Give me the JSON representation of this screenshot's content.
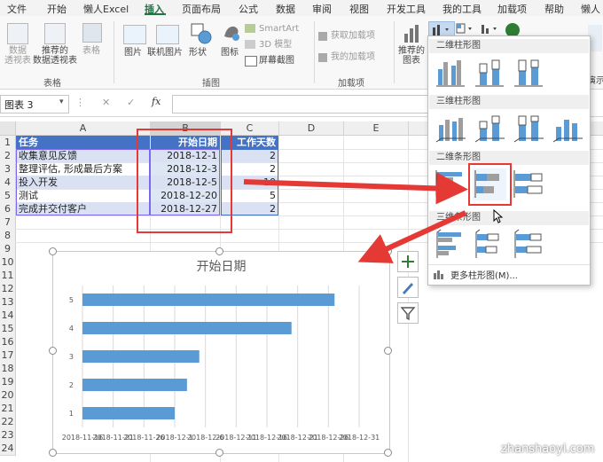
{
  "menu": {
    "tabs": [
      "文件",
      "开始",
      "懒人Excel",
      "插入",
      "页面布局",
      "公式",
      "数据",
      "审阅",
      "视图",
      "开发工具",
      "我的工具",
      "加载项",
      "帮助",
      "懒人"
    ],
    "active": "插入"
  },
  "ribbon": {
    "pivot_group": {
      "label": "表格",
      "items": [
        "数据\n透视表",
        "推荐的\n数据透视表",
        "表格"
      ]
    },
    "illustrations_group": {
      "label": "插图",
      "items": [
        "图片",
        "联机图片",
        "形状",
        "图标",
        "SmartArt",
        "3D 模型",
        "屏幕截图"
      ]
    },
    "addins_group": {
      "label": "加载项",
      "items": [
        "获取加载项",
        "我的加载项"
      ]
    },
    "recommended_charts": "推荐的\n图表",
    "demo_label": "演示"
  },
  "formula_bar": {
    "name_box": "图表 3",
    "fx": "fx",
    "cancel": "✕",
    "enter": "✓"
  },
  "sheet": {
    "columns": [
      "A",
      "B",
      "C",
      "D",
      "E"
    ],
    "row_numbers": [
      "1",
      "2",
      "3",
      "4",
      "5",
      "6",
      "7",
      "8",
      "9",
      "10",
      "11",
      "12",
      "13",
      "14",
      "15",
      "16",
      "17",
      "18",
      "19",
      "20",
      "21",
      "22",
      "23",
      "24"
    ],
    "headers": [
      "任务",
      "开始日期",
      "工作天数"
    ],
    "rows": [
      [
        "收集意见反馈",
        "2018-12-1",
        "2"
      ],
      [
        "整理评估, 形成最后方案",
        "2018-12-3",
        "2"
      ],
      [
        "投入开发",
        "2018-12-5",
        "10"
      ],
      [
        "测试",
        "2018-12-20",
        "5"
      ],
      [
        "完成并交付客户",
        "2018-12-27",
        "2"
      ]
    ]
  },
  "dropdown": {
    "sections": [
      "二维柱形图",
      "三维柱形图",
      "二维条形图",
      "三维条形图"
    ],
    "more": "更多柱形图(M)..."
  },
  "colors": {
    "accent": "#217346",
    "table_header": "#4472c4",
    "band": "#d9e1f2",
    "bar": "#5b9bd5",
    "highlight": "#e53935"
  },
  "chart_data": {
    "type": "bar",
    "orientation": "horizontal",
    "title": "开始日期",
    "categories": [
      "1",
      "2",
      "3",
      "4",
      "5"
    ],
    "values": [
      "2018-12-1",
      "2018-12-3",
      "2018-12-5",
      "2018-12-20",
      "2018-12-27"
    ],
    "xlim": [
      "2018-11-16",
      "2018-12-31"
    ],
    "x_tick_labels": [
      "2018-11-16",
      "2018-11-21",
      "2018-11-26",
      "2018-12-1",
      "2018-12-6",
      "2018-12-11",
      "2018-12-16",
      "2018-12-21",
      "2018-12-26",
      "2018-12-31"
    ],
    "grid": true,
    "legend": "none"
  },
  "watermark": "zhanshaoyi.com"
}
